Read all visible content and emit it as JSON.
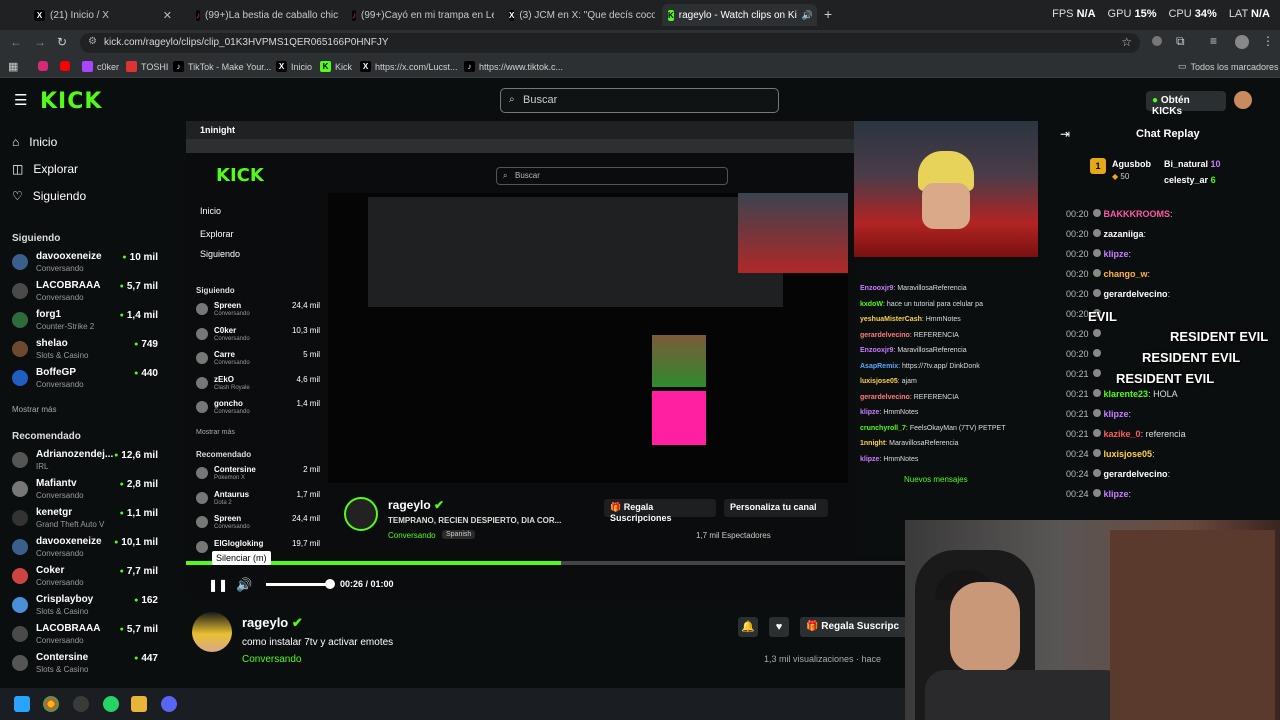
{
  "browser": {
    "tabs": [
      {
        "label": "(21) Inicio / X",
        "icon": "x-logo-icon"
      },
      {
        "label": "(99+)La bestia de caballo chico",
        "icon": "tiktok-icon"
      },
      {
        "label": "(99+)Cayó en mi trampa en Le",
        "icon": "tiktok-icon"
      },
      {
        "label": "(3) JCM en X: \"Que decís cocol",
        "icon": "x-logo-icon"
      },
      {
        "label": "rageylo - Watch clips on Ki",
        "icon": "kick-icon",
        "active": true
      }
    ],
    "new_tab": "+",
    "url": "kick.com/rageylo/clips/clip_01K3HVPMS1QER065166P0HNFJY",
    "bookmarks": [
      "c0ker",
      "TOSHI",
      "TikTok - Make Your...",
      "Inicio",
      "Kick",
      "https://x.com/Lucst...",
      "https://www.tiktok.c..."
    ],
    "all_bookmarks": "Todos los marcadores"
  },
  "overlay_stats": {
    "fps_label": "FPS",
    "fps_value": "N/A",
    "gpu_label": "GPU",
    "gpu_value": "15%",
    "cpu_label": "CPU",
    "cpu_value": "34%",
    "lat_label": "LAT",
    "lat_value": "N/A"
  },
  "kick": {
    "logo": "KICK",
    "search_placeholder": "Buscar",
    "get_kicks": "Obtén KICKs",
    "nav": [
      {
        "label": "Inicio",
        "icon": "home-icon"
      },
      {
        "label": "Explorar",
        "icon": "compass-icon"
      },
      {
        "label": "Siguiendo",
        "icon": "heart-icon"
      }
    ],
    "following_title": "Siguiendo",
    "following": [
      {
        "name": "davooxeneize",
        "category": "Conversando",
        "viewers": "10 mil",
        "color": "#3a5f8a"
      },
      {
        "name": "LACOBRAAA",
        "category": "Conversando",
        "viewers": "5,7 mil",
        "color": "#4a4a4a"
      },
      {
        "name": "forg1",
        "category": "Counter-Strike 2",
        "viewers": "1,4 mil",
        "color": "#2f6b3a"
      },
      {
        "name": "shelao",
        "category": "Slots & Casino",
        "viewers": "749",
        "color": "#6b4a2f"
      },
      {
        "name": "BoffeGP",
        "category": "Conversando",
        "viewers": "440",
        "color": "#1f5fbf"
      }
    ],
    "show_more": "Mostrar más",
    "recommended_title": "Recomendado",
    "recommended": [
      {
        "name": "Adrianozendej...",
        "category": "IRL",
        "viewers": "12,6 mil",
        "color": "#555"
      },
      {
        "name": "Mafiantv",
        "category": "Conversando",
        "viewers": "2,8 mil",
        "color": "#777"
      },
      {
        "name": "kenetgr",
        "category": "Grand Theft Auto V",
        "viewers": "1,1 mil",
        "color": "#333"
      },
      {
        "name": "davooxeneize",
        "category": "Conversando",
        "viewers": "10,1 mil",
        "color": "#3a5f8a"
      },
      {
        "name": "Coker",
        "category": "Conversando",
        "viewers": "7,7 mil",
        "color": "#c44"
      },
      {
        "name": "Crisplayboy",
        "category": "Slots & Casino",
        "viewers": "162",
        "color": "#4a8fd8"
      },
      {
        "name": "LACOBRAAA",
        "category": "Conversando",
        "viewers": "5,7 mil",
        "color": "#4a4a4a"
      },
      {
        "name": "Contersine",
        "category": "Slots & Casino",
        "viewers": "447",
        "color": "#555"
      }
    ]
  },
  "inner_stream": {
    "logo": "KICK",
    "search": "Buscar",
    "nav": [
      "Inicio",
      "Explorar",
      "Siguiendo"
    ],
    "following_title": "Siguiendo",
    "following": [
      {
        "name": "Spreen",
        "category": "Conversando",
        "viewers": "24,4 mil"
      },
      {
        "name": "C0ker",
        "category": "Conversando",
        "viewers": "10,3 mil"
      },
      {
        "name": "Carre",
        "category": "Conversando",
        "viewers": "5 mil"
      },
      {
        "name": "zEkO",
        "category": "Clash Royale",
        "viewers": "4,6 mil"
      },
      {
        "name": "goncho",
        "category": "Conversando",
        "viewers": "1,4 mil"
      }
    ],
    "show_more": "Mostrar más",
    "recommended_title": "Recomendado",
    "recommended": [
      {
        "name": "Contersine",
        "category": "Pokemon X",
        "viewers": "2 mil"
      },
      {
        "name": "Antaurus",
        "category": "Dota 2",
        "viewers": "1,7 mil"
      },
      {
        "name": "Spreen",
        "category": "Conversando",
        "viewers": "24,4 mil"
      },
      {
        "name": "ElGlogloking",
        "category": "",
        "viewers": "19,7 mil"
      }
    ],
    "streamer": "rageylo",
    "stream_title": "TEMPRANO, RECIEN DESPIERTO, DIA COR...",
    "category": "Conversando",
    "language": "Spanish",
    "gift_subs": "Regala Suscripciones",
    "customize": "Personaliza tu canal",
    "viewers": "1,7 mil",
    "viewers_label": "Espectadores",
    "chat_lines": [
      {
        "user": "Enzooxjr9",
        "msg": "MaravillosaReferencia",
        "color": "#c77dff"
      },
      {
        "user": "kxdoW",
        "msg": "hace un tutorial para celular pa",
        "color": "#53fc18"
      },
      {
        "user": "yeshuaMisterCash",
        "msg": "HmmNotes",
        "color": "#ffd24a"
      },
      {
        "user": "gerardelvecino",
        "msg": "REFERENCIA",
        "color": "#ff7a7a"
      },
      {
        "user": "Enzooxjr9",
        "msg": "MaravillosaReferencia",
        "color": "#c77dff"
      },
      {
        "user": "AsapRemix",
        "msg": "https://7tv.app/ DinkDonk",
        "color": "#5aa9ff"
      },
      {
        "user": "luxisjose05",
        "msg": "ajam",
        "color": "#ffd24a"
      },
      {
        "user": "gerardelvecino",
        "msg": "REFERENCIA",
        "color": "#ff7a7a"
      },
      {
        "user": "klipze",
        "msg": "HmmNotes",
        "color": "#c77dff"
      },
      {
        "user": "crunchyroll_7",
        "msg": "FeelsOkayMan (7TV) PETPET",
        "color": "#53fc18"
      },
      {
        "user": "1nnight",
        "msg": "MaravillosaReferencia",
        "color": "#ffd24a"
      },
      {
        "user": "klipze",
        "msg": "HmmNotes",
        "color": "#c77dff"
      }
    ],
    "new_messages": "Nuevos mensajes"
  },
  "player": {
    "mute_tooltip": "Silenciar (m)",
    "time": "00:26 / 01:00",
    "progress": 0.44
  },
  "clip": {
    "streamer": "rageylo",
    "title": "como instalar 7tv y activar emotes",
    "category": "Conversando",
    "gift_subs": "Regala Suscripc",
    "views": "1,3 mil visualizaciones · hace"
  },
  "chat": {
    "title": "Chat Replay",
    "top_gifters": [
      {
        "rank": "1",
        "name": "Agusbob",
        "count": "50"
      },
      {
        "name": "Bi_natural",
        "count": "10"
      },
      {
        "name": "celesty_ar",
        "count": "6"
      }
    ],
    "messages": [
      {
        "time": "00:20",
        "user": "BAKKKROOMS",
        "msg": "",
        "color": "#ff5aa5"
      },
      {
        "time": "00:20",
        "user": "zazaniiga",
        "msg": "",
        "color": "#ffffff"
      },
      {
        "time": "00:20",
        "user": "klipze",
        "msg": "",
        "color": "#c77dff"
      },
      {
        "time": "00:20",
        "user": "chango_w",
        "msg": "",
        "color": "#ffb347"
      },
      {
        "time": "00:20",
        "user": "gerardelvecino",
        "msg": "",
        "color": "#ffffff"
      },
      {
        "time": "00:20",
        "user": "",
        "msg": "",
        "color": "#ffffff"
      },
      {
        "time": "00:20",
        "user": "",
        "msg": "",
        "color": "#ffffff"
      },
      {
        "time": "00:20",
        "user": "",
        "msg": "",
        "color": "#ffffff"
      },
      {
        "time": "00:21",
        "user": "",
        "msg": "",
        "color": "#ffffff"
      },
      {
        "time": "00:21",
        "user": "klarente23",
        "msg": "HOLA",
        "color": "#53fc18"
      },
      {
        "time": "00:21",
        "user": "klipze",
        "msg": "",
        "color": "#c77dff"
      },
      {
        "time": "00:21",
        "user": "kazike_0",
        "msg": "referencia",
        "color": "#ff5a5a"
      },
      {
        "time": "00:24",
        "user": "luxisjose05",
        "msg": "",
        "color": "#ffd24a"
      },
      {
        "time": "00:24",
        "user": "gerardelvecino",
        "msg": "",
        "color": "#ffffff"
      },
      {
        "time": "00:24",
        "user": "klipze",
        "msg": "",
        "color": "#c77dff"
      }
    ],
    "spam_text": [
      "EVIL",
      "RESIDENT EVIL",
      "RESIDENT EVIL",
      "RESIDENT EVIL",
      "RESIDENT EVIL"
    ]
  },
  "colors": {
    "kick_green": "#53fc18",
    "bg": "#0b0e0f"
  }
}
